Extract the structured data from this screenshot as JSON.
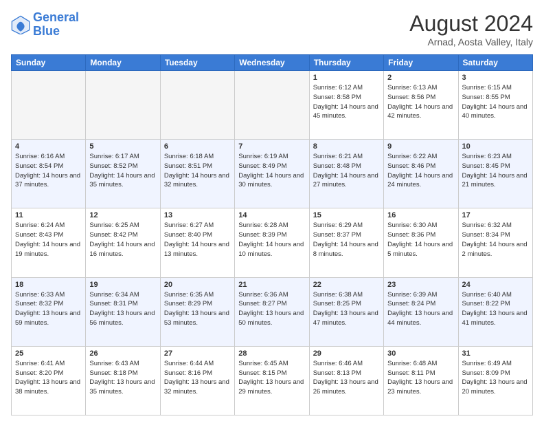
{
  "logo": {
    "line1": "General",
    "line2": "Blue"
  },
  "title": "August 2024",
  "location": "Arnad, Aosta Valley, Italy",
  "headers": [
    "Sunday",
    "Monday",
    "Tuesday",
    "Wednesday",
    "Thursday",
    "Friday",
    "Saturday"
  ],
  "weeks": [
    [
      {
        "day": "",
        "info": ""
      },
      {
        "day": "",
        "info": ""
      },
      {
        "day": "",
        "info": ""
      },
      {
        "day": "",
        "info": ""
      },
      {
        "day": "1",
        "info": "Sunrise: 6:12 AM\nSunset: 8:58 PM\nDaylight: 14 hours and 45 minutes."
      },
      {
        "day": "2",
        "info": "Sunrise: 6:13 AM\nSunset: 8:56 PM\nDaylight: 14 hours and 42 minutes."
      },
      {
        "day": "3",
        "info": "Sunrise: 6:15 AM\nSunset: 8:55 PM\nDaylight: 14 hours and 40 minutes."
      }
    ],
    [
      {
        "day": "4",
        "info": "Sunrise: 6:16 AM\nSunset: 8:54 PM\nDaylight: 14 hours and 37 minutes."
      },
      {
        "day": "5",
        "info": "Sunrise: 6:17 AM\nSunset: 8:52 PM\nDaylight: 14 hours and 35 minutes."
      },
      {
        "day": "6",
        "info": "Sunrise: 6:18 AM\nSunset: 8:51 PM\nDaylight: 14 hours and 32 minutes."
      },
      {
        "day": "7",
        "info": "Sunrise: 6:19 AM\nSunset: 8:49 PM\nDaylight: 14 hours and 30 minutes."
      },
      {
        "day": "8",
        "info": "Sunrise: 6:21 AM\nSunset: 8:48 PM\nDaylight: 14 hours and 27 minutes."
      },
      {
        "day": "9",
        "info": "Sunrise: 6:22 AM\nSunset: 8:46 PM\nDaylight: 14 hours and 24 minutes."
      },
      {
        "day": "10",
        "info": "Sunrise: 6:23 AM\nSunset: 8:45 PM\nDaylight: 14 hours and 21 minutes."
      }
    ],
    [
      {
        "day": "11",
        "info": "Sunrise: 6:24 AM\nSunset: 8:43 PM\nDaylight: 14 hours and 19 minutes."
      },
      {
        "day": "12",
        "info": "Sunrise: 6:25 AM\nSunset: 8:42 PM\nDaylight: 14 hours and 16 minutes."
      },
      {
        "day": "13",
        "info": "Sunrise: 6:27 AM\nSunset: 8:40 PM\nDaylight: 14 hours and 13 minutes."
      },
      {
        "day": "14",
        "info": "Sunrise: 6:28 AM\nSunset: 8:39 PM\nDaylight: 14 hours and 10 minutes."
      },
      {
        "day": "15",
        "info": "Sunrise: 6:29 AM\nSunset: 8:37 PM\nDaylight: 14 hours and 8 minutes."
      },
      {
        "day": "16",
        "info": "Sunrise: 6:30 AM\nSunset: 8:36 PM\nDaylight: 14 hours and 5 minutes."
      },
      {
        "day": "17",
        "info": "Sunrise: 6:32 AM\nSunset: 8:34 PM\nDaylight: 14 hours and 2 minutes."
      }
    ],
    [
      {
        "day": "18",
        "info": "Sunrise: 6:33 AM\nSunset: 8:32 PM\nDaylight: 13 hours and 59 minutes."
      },
      {
        "day": "19",
        "info": "Sunrise: 6:34 AM\nSunset: 8:31 PM\nDaylight: 13 hours and 56 minutes."
      },
      {
        "day": "20",
        "info": "Sunrise: 6:35 AM\nSunset: 8:29 PM\nDaylight: 13 hours and 53 minutes."
      },
      {
        "day": "21",
        "info": "Sunrise: 6:36 AM\nSunset: 8:27 PM\nDaylight: 13 hours and 50 minutes."
      },
      {
        "day": "22",
        "info": "Sunrise: 6:38 AM\nSunset: 8:25 PM\nDaylight: 13 hours and 47 minutes."
      },
      {
        "day": "23",
        "info": "Sunrise: 6:39 AM\nSunset: 8:24 PM\nDaylight: 13 hours and 44 minutes."
      },
      {
        "day": "24",
        "info": "Sunrise: 6:40 AM\nSunset: 8:22 PM\nDaylight: 13 hours and 41 minutes."
      }
    ],
    [
      {
        "day": "25",
        "info": "Sunrise: 6:41 AM\nSunset: 8:20 PM\nDaylight: 13 hours and 38 minutes."
      },
      {
        "day": "26",
        "info": "Sunrise: 6:43 AM\nSunset: 8:18 PM\nDaylight: 13 hours and 35 minutes."
      },
      {
        "day": "27",
        "info": "Sunrise: 6:44 AM\nSunset: 8:16 PM\nDaylight: 13 hours and 32 minutes."
      },
      {
        "day": "28",
        "info": "Sunrise: 6:45 AM\nSunset: 8:15 PM\nDaylight: 13 hours and 29 minutes."
      },
      {
        "day": "29",
        "info": "Sunrise: 6:46 AM\nSunset: 8:13 PM\nDaylight: 13 hours and 26 minutes."
      },
      {
        "day": "30",
        "info": "Sunrise: 6:48 AM\nSunset: 8:11 PM\nDaylight: 13 hours and 23 minutes."
      },
      {
        "day": "31",
        "info": "Sunrise: 6:49 AM\nSunset: 8:09 PM\nDaylight: 13 hours and 20 minutes."
      }
    ]
  ]
}
